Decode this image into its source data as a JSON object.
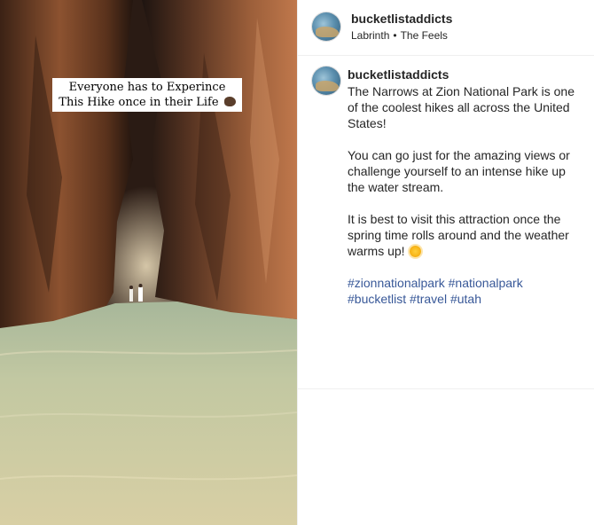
{
  "post": {
    "author": {
      "username": "bucketlistaddicts",
      "avatar_icon": "profile-avatar-landscape"
    },
    "audio": {
      "artist": "Labrinth",
      "separator": "•",
      "track": "The Feels"
    },
    "media": {
      "overlay_line1": "Everyone has to Experince",
      "overlay_line2": "This Hike once in their Life",
      "overlay_emoji": "rock-emoji"
    },
    "caption": {
      "username": "bucketlistaddicts",
      "paragraph1": "The Narrows at Zion National Park is one of the coolest hikes all across the United States!",
      "paragraph2": "You can go just for the amazing views or challenge yourself to an intense hike up the water stream.",
      "paragraph3": "It is best to visit this attraction once the spring time rolls around and the weather warms up!",
      "paragraph3_emoji": "sun-emoji",
      "hashtags": [
        "#zionnationalpark",
        "#nationalpark",
        "#bucketlist",
        "#travel",
        "#utah"
      ]
    }
  },
  "colors": {
    "hashtag": "#385898",
    "text": "#262626",
    "border": "#efefef"
  }
}
